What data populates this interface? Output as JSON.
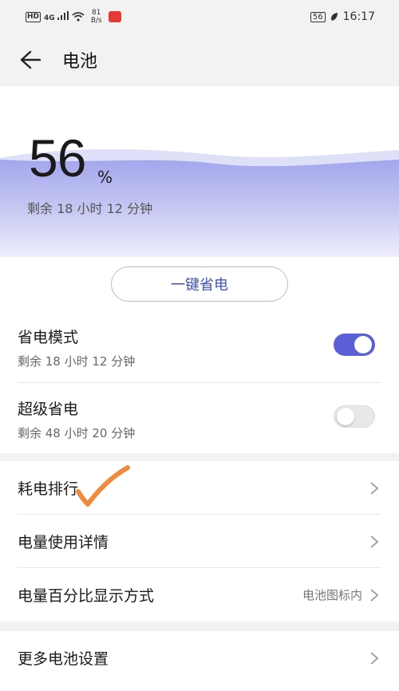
{
  "status_bar": {
    "hd": "HD",
    "signal": "4G",
    "speed_value": "81",
    "speed_unit": "B/s",
    "battery": "56",
    "time": "16:17"
  },
  "header": {
    "title": "电池",
    "back_icon": "arrow-left-icon"
  },
  "battery": {
    "percent": "56",
    "percent_sign": "%",
    "remaining": "剩余 18 小时 12 分钟",
    "wave_color": "#8f93e8"
  },
  "one_key_save": {
    "label": "一键省电"
  },
  "modes": [
    {
      "title": "省电模式",
      "subtitle": "剩余 18 小时 12 分钟",
      "enabled": true
    },
    {
      "title": "超级省电",
      "subtitle": "剩余 48 小时 20 分钟",
      "enabled": false
    }
  ],
  "menu": [
    {
      "label": "耗电排行",
      "value": ""
    },
    {
      "label": "电量使用详情",
      "value": ""
    },
    {
      "label": "电量百分比显示方式",
      "value": "电池图标内"
    }
  ],
  "more": {
    "label": "更多电池设置"
  },
  "colors": {
    "accent": "#5a5fd8",
    "button_text": "#3f51b5",
    "annotation": "#f08a3c"
  }
}
